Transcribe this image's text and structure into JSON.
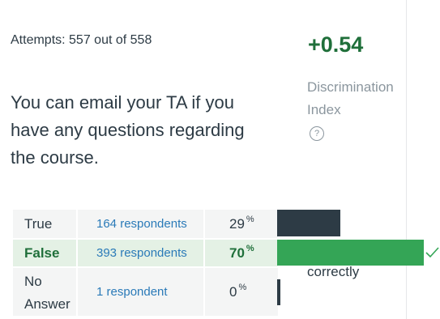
{
  "question": {
    "attempts_text": "Attempts: 557 out of 558",
    "text": "You can email your TA if you have any questions regarding the course."
  },
  "discrimination": {
    "value": "+0.54",
    "label": "Discrimination Index",
    "help_icon": "question-circle-icon"
  },
  "answers": [
    {
      "label": "True",
      "respondents": "164 respondents",
      "percent": "29",
      "fraction": 0.29,
      "correct": false
    },
    {
      "label": "False",
      "respondents": "393 respondents",
      "percent": "70",
      "fraction": 0.7,
      "correct": true
    },
    {
      "label": "No Answer",
      "respondents": "1 respondent",
      "percent": "0",
      "fraction": 0.0,
      "correct": false
    }
  ],
  "percent_sign": "%",
  "correct_note": "correctly",
  "colors": {
    "correct_bar": "#34a556",
    "incorrect_bar": "#2d3b45",
    "correct_row_bg": "#e4f1e5",
    "link": "#2a7ab8"
  }
}
